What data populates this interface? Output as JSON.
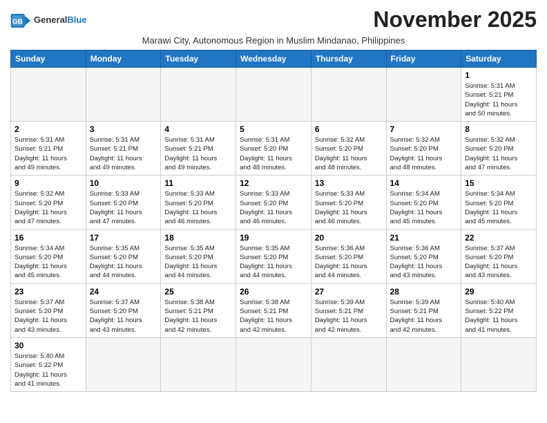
{
  "header": {
    "logo_general": "General",
    "logo_blue": "Blue",
    "month_title": "November 2025",
    "subtitle": "Marawi City, Autonomous Region in Muslim Mindanao, Philippines"
  },
  "weekdays": [
    "Sunday",
    "Monday",
    "Tuesday",
    "Wednesday",
    "Thursday",
    "Friday",
    "Saturday"
  ],
  "weeks": [
    [
      {
        "day": "",
        "info": ""
      },
      {
        "day": "",
        "info": ""
      },
      {
        "day": "",
        "info": ""
      },
      {
        "day": "",
        "info": ""
      },
      {
        "day": "",
        "info": ""
      },
      {
        "day": "",
        "info": ""
      },
      {
        "day": "1",
        "info": "Sunrise: 5:31 AM\nSunset: 5:21 PM\nDaylight: 11 hours\nand 50 minutes."
      }
    ],
    [
      {
        "day": "2",
        "info": "Sunrise: 5:31 AM\nSunset: 5:21 PM\nDaylight: 11 hours\nand 49 minutes."
      },
      {
        "day": "3",
        "info": "Sunrise: 5:31 AM\nSunset: 5:21 PM\nDaylight: 11 hours\nand 49 minutes."
      },
      {
        "day": "4",
        "info": "Sunrise: 5:31 AM\nSunset: 5:21 PM\nDaylight: 11 hours\nand 49 minutes."
      },
      {
        "day": "5",
        "info": "Sunrise: 5:31 AM\nSunset: 5:20 PM\nDaylight: 11 hours\nand 48 minutes."
      },
      {
        "day": "6",
        "info": "Sunrise: 5:32 AM\nSunset: 5:20 PM\nDaylight: 11 hours\nand 48 minutes."
      },
      {
        "day": "7",
        "info": "Sunrise: 5:32 AM\nSunset: 5:20 PM\nDaylight: 11 hours\nand 48 minutes."
      },
      {
        "day": "8",
        "info": "Sunrise: 5:32 AM\nSunset: 5:20 PM\nDaylight: 11 hours\nand 47 minutes."
      }
    ],
    [
      {
        "day": "9",
        "info": "Sunrise: 5:32 AM\nSunset: 5:20 PM\nDaylight: 11 hours\nand 47 minutes."
      },
      {
        "day": "10",
        "info": "Sunrise: 5:33 AM\nSunset: 5:20 PM\nDaylight: 11 hours\nand 47 minutes."
      },
      {
        "day": "11",
        "info": "Sunrise: 5:33 AM\nSunset: 5:20 PM\nDaylight: 11 hours\nand 46 minutes."
      },
      {
        "day": "12",
        "info": "Sunrise: 5:33 AM\nSunset: 5:20 PM\nDaylight: 11 hours\nand 46 minutes."
      },
      {
        "day": "13",
        "info": "Sunrise: 5:33 AM\nSunset: 5:20 PM\nDaylight: 11 hours\nand 46 minutes."
      },
      {
        "day": "14",
        "info": "Sunrise: 5:34 AM\nSunset: 5:20 PM\nDaylight: 11 hours\nand 45 minutes."
      },
      {
        "day": "15",
        "info": "Sunrise: 5:34 AM\nSunset: 5:20 PM\nDaylight: 11 hours\nand 45 minutes."
      }
    ],
    [
      {
        "day": "16",
        "info": "Sunrise: 5:34 AM\nSunset: 5:20 PM\nDaylight: 11 hours\nand 45 minutes."
      },
      {
        "day": "17",
        "info": "Sunrise: 5:35 AM\nSunset: 5:20 PM\nDaylight: 11 hours\nand 44 minutes."
      },
      {
        "day": "18",
        "info": "Sunrise: 5:35 AM\nSunset: 5:20 PM\nDaylight: 11 hours\nand 44 minutes."
      },
      {
        "day": "19",
        "info": "Sunrise: 5:35 AM\nSunset: 5:20 PM\nDaylight: 11 hours\nand 44 minutes."
      },
      {
        "day": "20",
        "info": "Sunrise: 5:36 AM\nSunset: 5:20 PM\nDaylight: 11 hours\nand 44 minutes."
      },
      {
        "day": "21",
        "info": "Sunrise: 5:36 AM\nSunset: 5:20 PM\nDaylight: 11 hours\nand 43 minutes."
      },
      {
        "day": "22",
        "info": "Sunrise: 5:37 AM\nSunset: 5:20 PM\nDaylight: 11 hours\nand 43 minutes."
      }
    ],
    [
      {
        "day": "23",
        "info": "Sunrise: 5:37 AM\nSunset: 5:20 PM\nDaylight: 11 hours\nand 43 minutes."
      },
      {
        "day": "24",
        "info": "Sunrise: 5:37 AM\nSunset: 5:20 PM\nDaylight: 11 hours\nand 43 minutes."
      },
      {
        "day": "25",
        "info": "Sunrise: 5:38 AM\nSunset: 5:21 PM\nDaylight: 11 hours\nand 42 minutes."
      },
      {
        "day": "26",
        "info": "Sunrise: 5:38 AM\nSunset: 5:21 PM\nDaylight: 11 hours\nand 42 minutes."
      },
      {
        "day": "27",
        "info": "Sunrise: 5:39 AM\nSunset: 5:21 PM\nDaylight: 11 hours\nand 42 minutes."
      },
      {
        "day": "28",
        "info": "Sunrise: 5:39 AM\nSunset: 5:21 PM\nDaylight: 11 hours\nand 42 minutes."
      },
      {
        "day": "29",
        "info": "Sunrise: 5:40 AM\nSunset: 5:22 PM\nDaylight: 11 hours\nand 41 minutes."
      }
    ],
    [
      {
        "day": "30",
        "info": "Sunrise: 5:40 AM\nSunset: 5:22 PM\nDaylight: 11 hours\nand 41 minutes."
      },
      {
        "day": "",
        "info": ""
      },
      {
        "day": "",
        "info": ""
      },
      {
        "day": "",
        "info": ""
      },
      {
        "day": "",
        "info": ""
      },
      {
        "day": "",
        "info": ""
      },
      {
        "day": "",
        "info": ""
      }
    ]
  ]
}
